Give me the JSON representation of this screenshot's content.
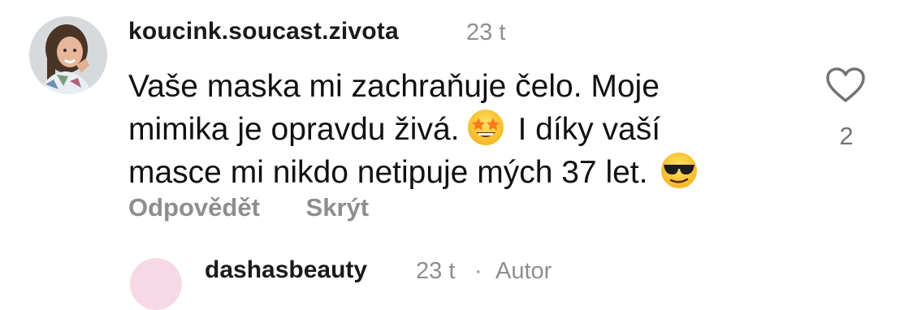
{
  "comment": {
    "username": "koucink.soucast.zivota",
    "time": "23 t",
    "text_lines": [
      "Vaše maska mi zachraňuje čelo. Moje",
      "mimika je opravdu živá.",
      "I díky vaší",
      "masce mi nikdo netipuje mých 37 let."
    ],
    "emoji_1": "star-struck-emoji",
    "emoji_2": "sunglasses-emoji",
    "like_count": "2",
    "actions": {
      "reply_label": "Odpovědět",
      "hide_label": "Skrýt"
    }
  },
  "next_comment": {
    "username": "dashasbeauty",
    "time": "23 t",
    "separator": "·",
    "author_label": "Autor"
  },
  "colors": {
    "secondary_text": "#8e8e8e",
    "primary_text": "#111111"
  }
}
